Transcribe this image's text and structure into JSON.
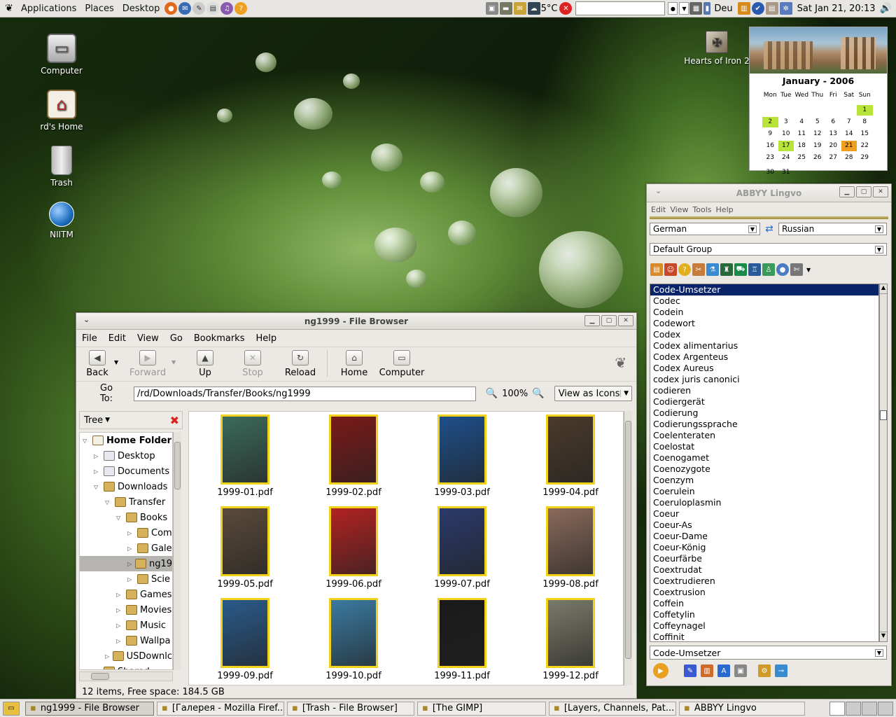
{
  "top_panel": {
    "menus": [
      "Applications",
      "Places",
      "Desktop"
    ],
    "weather": "5°C",
    "keyboard_layout": "Deu",
    "clock": "Sat Jan 21, 20:13"
  },
  "desktop_icons": [
    {
      "label": "Computer",
      "icon": "computer-icon"
    },
    {
      "label": "rd's Home",
      "icon": "home-icon"
    },
    {
      "label": "Trash",
      "icon": "trash-icon"
    },
    {
      "label": "NIITM",
      "icon": "globe-icon"
    }
  ],
  "desktop_launcher": {
    "label": "Hearts of Iron 2"
  },
  "calendar": {
    "title": "January - 2006",
    "weekdays": [
      "Mon",
      "Tue",
      "Wed",
      "Thu",
      "Fri",
      "Sat",
      "Sun"
    ],
    "weeks": [
      [
        "",
        "",
        "",
        "",
        "",
        "",
        "1"
      ],
      [
        "2",
        "3",
        "4",
        "5",
        "6",
        "7",
        "8"
      ],
      [
        "9",
        "10",
        "11",
        "12",
        "13",
        "14",
        "15"
      ],
      [
        "16",
        "17",
        "18",
        "19",
        "20",
        "21",
        "22"
      ],
      [
        "23",
        "24",
        "25",
        "26",
        "27",
        "28",
        "29"
      ],
      [
        "30",
        "31",
        "",
        "",
        "",
        "",
        ""
      ]
    ],
    "highlight_days": [
      "1",
      "2",
      "17"
    ],
    "today": "21"
  },
  "file_browser": {
    "title": "ng1999 - File Browser",
    "menus": [
      "File",
      "Edit",
      "View",
      "Go",
      "Bookmarks",
      "Help"
    ],
    "toolbar": {
      "back": "Back",
      "forward": "Forward",
      "up": "Up",
      "stop": "Stop",
      "reload": "Reload",
      "home": "Home",
      "computer": "Computer"
    },
    "goto_label": "Go To:",
    "location": "/rd/Downloads/Transfer/Books/ng1999",
    "zoom": "100%",
    "view_mode": "View as Icons",
    "sidebar_mode": "Tree",
    "tree": [
      {
        "label": "Home Folder",
        "depth": 0,
        "expanded": true
      },
      {
        "label": "Desktop",
        "depth": 1
      },
      {
        "label": "Documents",
        "depth": 1
      },
      {
        "label": "Downloads",
        "depth": 1,
        "expanded": true
      },
      {
        "label": "Transfer",
        "depth": 2,
        "expanded": true
      },
      {
        "label": "Books",
        "depth": 3,
        "expanded": true
      },
      {
        "label": "Com",
        "depth": 4
      },
      {
        "label": "Gale",
        "depth": 4
      },
      {
        "label": "ng19",
        "depth": 4,
        "selected": true
      },
      {
        "label": "Scie",
        "depth": 4
      },
      {
        "label": "Games",
        "depth": 3
      },
      {
        "label": "Movies",
        "depth": 3
      },
      {
        "label": "Music",
        "depth": 3
      },
      {
        "label": "Wallpa",
        "depth": 3
      },
      {
        "label": "USDownlc",
        "depth": 2
      },
      {
        "label": "Shared",
        "depth": 1
      }
    ],
    "files": [
      {
        "name": "1999-01.pdf",
        "color": "#3c6a5a"
      },
      {
        "name": "1999-02.pdf",
        "color": "#7a1a18"
      },
      {
        "name": "1999-03.pdf",
        "color": "#1d4f8a"
      },
      {
        "name": "1999-04.pdf",
        "color": "#4a3a2a"
      },
      {
        "name": "1999-05.pdf",
        "color": "#5a4a3a"
      },
      {
        "name": "1999-06.pdf",
        "color": "#b22222"
      },
      {
        "name": "1999-07.pdf",
        "color": "#2a3a6a"
      },
      {
        "name": "1999-08.pdf",
        "color": "#8a6a5a"
      },
      {
        "name": "1999-09.pdf",
        "color": "#2a5a8a"
      },
      {
        "name": "1999-10.pdf",
        "color": "#3a7aa0"
      },
      {
        "name": "1999-11.pdf",
        "color": "#1a1a1a"
      },
      {
        "name": "1999-12.pdf",
        "color": "#7a7a6a"
      }
    ],
    "status": "12 items, Free space: 184.5 GB"
  },
  "lingvo": {
    "title": "ABBYY Lingvo",
    "menus": [
      "Edit",
      "View",
      "Tools",
      "Help"
    ],
    "source_lang": "German",
    "target_lang": "Russian",
    "group": "Default Group",
    "words": [
      "Code-Umsetzer",
      "Codec",
      "Codein",
      "Codewort",
      "Codex",
      "Codex alimentarius",
      "Codex Argenteus",
      "Codex Aureus",
      "codex juris canonici",
      "codieren",
      "Codiergerät",
      "Codierung",
      "Codierungssprache",
      "Coelenteraten",
      "Coelostat",
      "Coenogamet",
      "Coenozygote",
      "Coenzym",
      "Coerulein",
      "Coeruloplasmin",
      "Coeur",
      "Coeur-As",
      "Coeur-Dame",
      "Coeur-König",
      "Coeurfärbe",
      "Coextrudat",
      "Coextrudieren",
      "Coextrusion",
      "Coffein",
      "Coffetylin",
      "Coffeynagel",
      "Coffinit"
    ],
    "selected_word": "Code-Umsetzer",
    "search_value": "Code-Umsetzer"
  },
  "taskbar": [
    {
      "label": "ng1999 - File Browser",
      "active": true
    },
    {
      "label": "[Галерея - Mozilla Firef..."
    },
    {
      "label": "[Trash - File Browser]"
    },
    {
      "label": "[The GIMP]"
    },
    {
      "label": "[Layers, Channels, Pat..."
    },
    {
      "label": "ABBYY Lingvo"
    }
  ]
}
